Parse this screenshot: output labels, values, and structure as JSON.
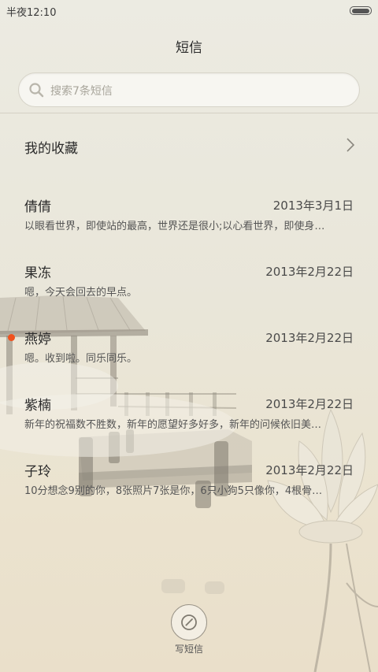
{
  "status_bar": {
    "time": "半夜12:10"
  },
  "header": {
    "title": "短信"
  },
  "search": {
    "placeholder": "搜索7条短信"
  },
  "favorites": {
    "label": "我的收藏"
  },
  "messages": [
    {
      "name": "倩倩",
      "date": "2013年3月1日",
      "preview": "以眼看世界，即使站的最高，世界还是很小;以心看世界，即使身…",
      "unread": false
    },
    {
      "name": "果冻",
      "date": "2013年2月22日",
      "preview": "嗯，今天会回去的早点。",
      "unread": false
    },
    {
      "name": "燕婷",
      "date": "2013年2月22日",
      "preview": "嗯。收到啦。同乐同乐。",
      "unread": true
    },
    {
      "name": "紫楠",
      "date": "2013年2月22日",
      "preview": "新年的祝福数不胜数，新年的愿望好多好多，新年的问候依旧美…",
      "unread": false
    },
    {
      "name": "子玲",
      "date": "2013年2月22日",
      "preview": "10分想念9别的你，8张照片7张是你，6只小狗5只像你，4根骨…",
      "unread": false
    }
  ],
  "compose": {
    "label": "写短信"
  },
  "colors": {
    "unread_dot": "#f0521e",
    "background": "#ebe8dc"
  }
}
